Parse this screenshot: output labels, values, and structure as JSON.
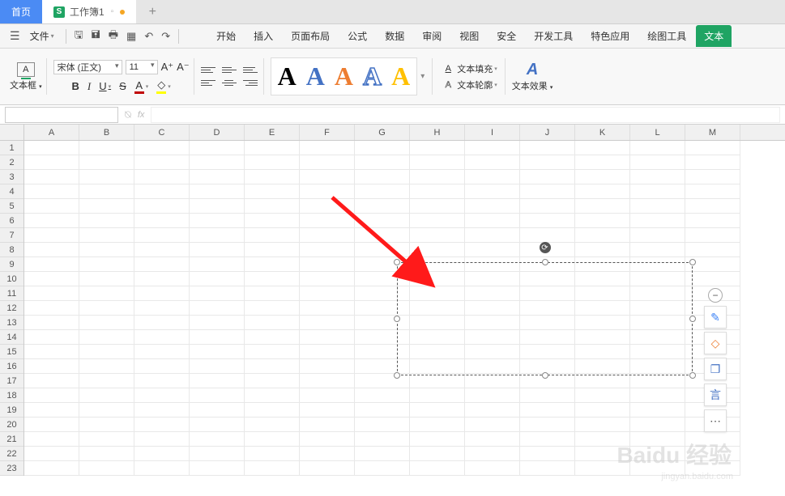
{
  "tabs": {
    "home": "首页",
    "workbook": "工作簿1",
    "workbook_icon": "S",
    "newtab": "+"
  },
  "menu": {
    "file": "文件",
    "items": [
      "开始",
      "插入",
      "页面布局",
      "公式",
      "数据",
      "审阅",
      "视图",
      "安全",
      "开发工具",
      "特色应用",
      "绘图工具",
      "文本"
    ]
  },
  "ribbon": {
    "textbox_label": "文本框",
    "textbox_icon": "A",
    "font_name": "宋体 (正文)",
    "font_size": "11",
    "bold": "B",
    "italic": "I",
    "underline": "U",
    "strike": "S",
    "font_color_letter": "A",
    "wordart": "A",
    "text_fill": "文本填充",
    "text_outline": "文本轮廓",
    "text_fill_letter": "A",
    "text_outline_letter": "A",
    "text_effect": "文本效果",
    "text_effect_icon": "A"
  },
  "formula": {
    "fx": "fx"
  },
  "grid": {
    "cols": [
      "A",
      "B",
      "C",
      "D",
      "E",
      "F",
      "G",
      "H",
      "I",
      "J",
      "K",
      "L",
      "M"
    ],
    "rows": [
      "1",
      "2",
      "3",
      "4",
      "5",
      "6",
      "7",
      "8",
      "9",
      "10",
      "11",
      "12",
      "13",
      "14",
      "15",
      "16",
      "17",
      "18",
      "19",
      "20",
      "21",
      "22",
      "23"
    ]
  },
  "side_tools": {
    "minus": "−",
    "pen": "✎",
    "eraser": "◇",
    "copy": "❐",
    "text": "言",
    "more": "⋯"
  },
  "watermark": {
    "main": "Baidu 经验",
    "sub": "jingyan.baidu.com"
  }
}
